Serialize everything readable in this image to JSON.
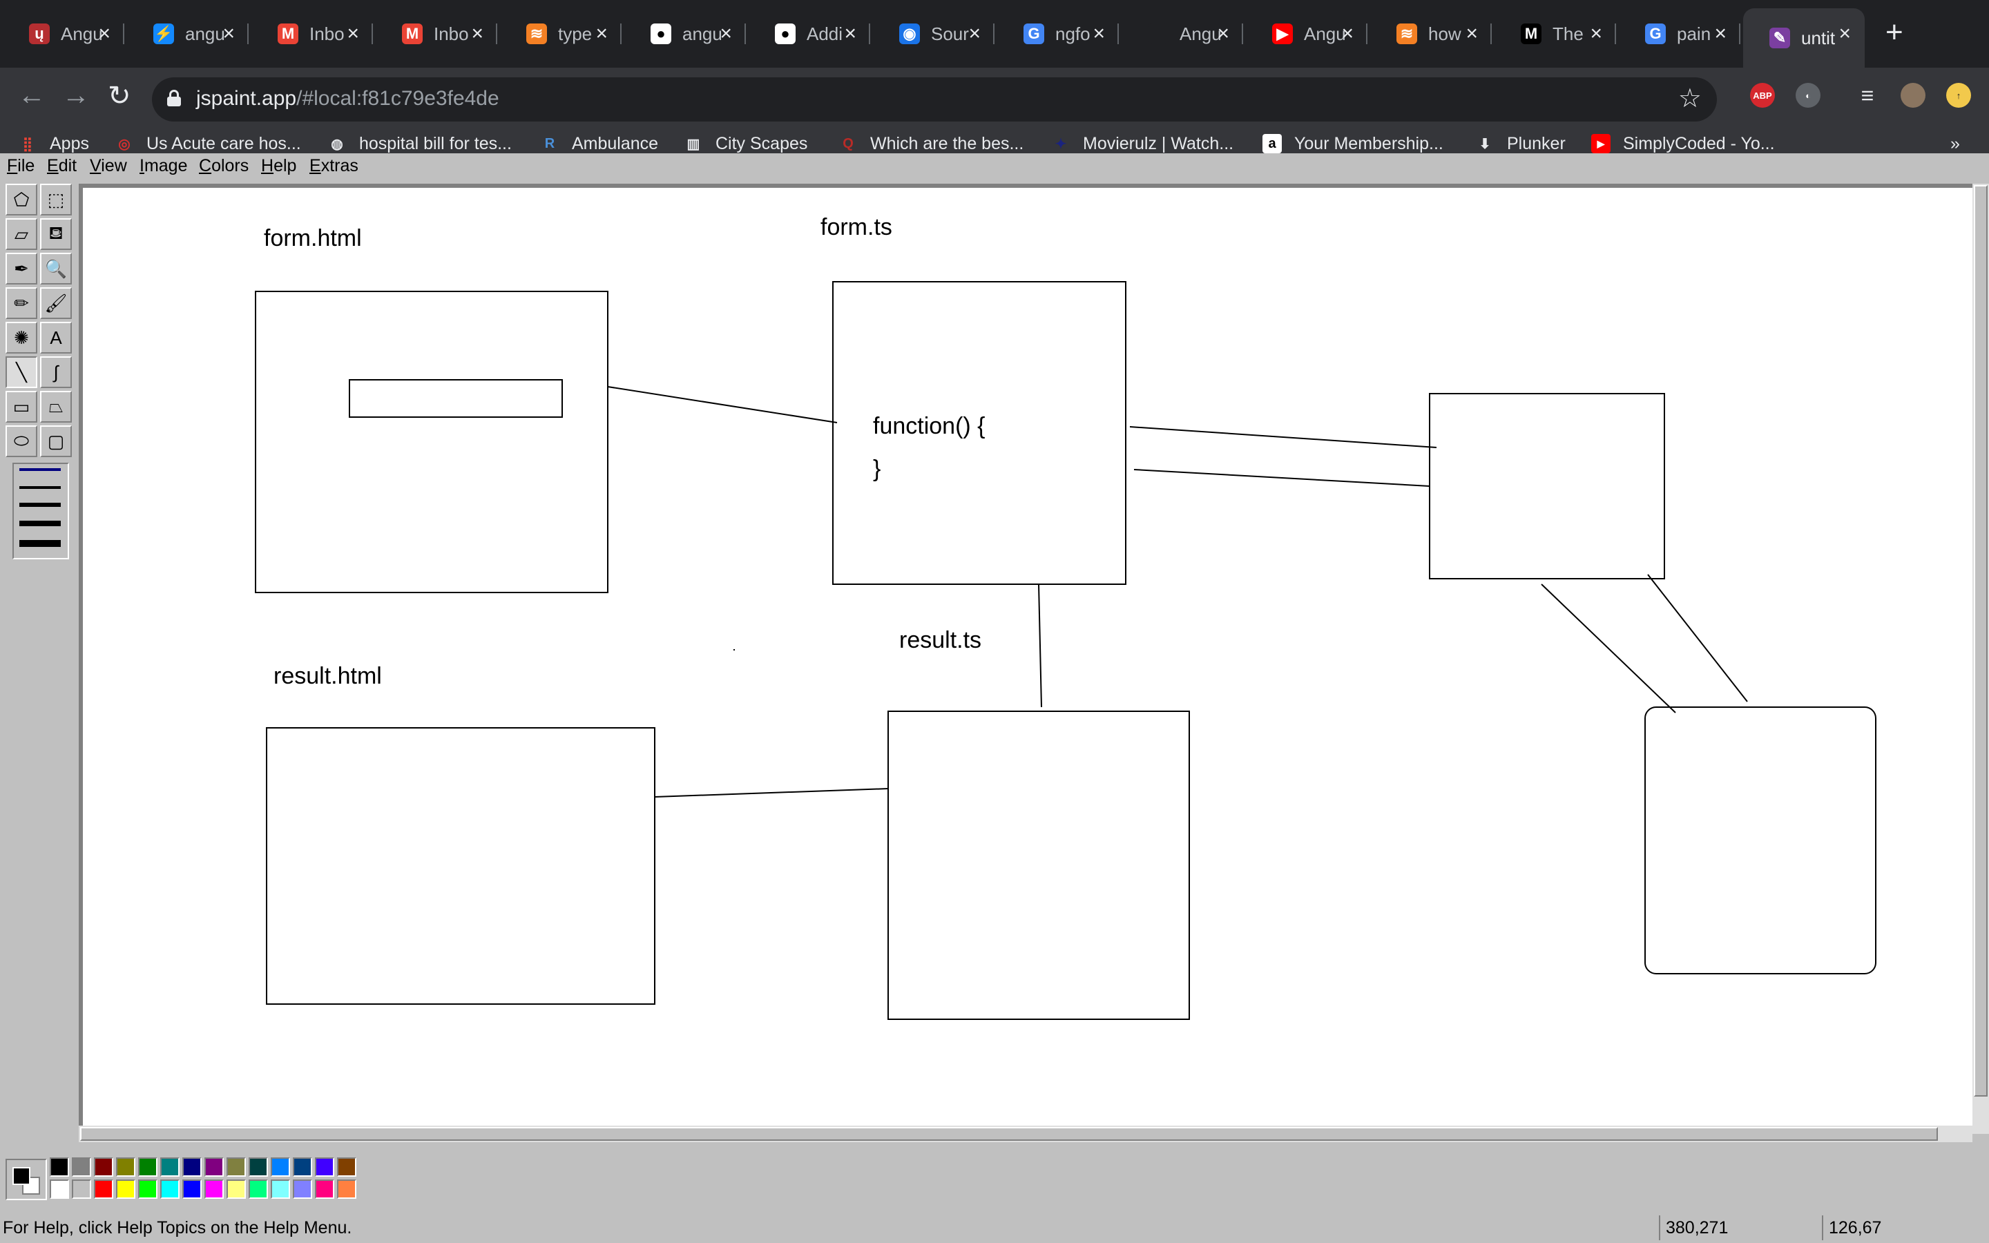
{
  "browser": {
    "tabs": [
      {
        "title": "Angu",
        "icon": "angular-icon",
        "color": "#b52e31",
        "glyph": "ų"
      },
      {
        "title": "angu",
        "icon": "stackblitz-icon",
        "color": "#1389fd",
        "glyph": "⚡"
      },
      {
        "title": "Inbo",
        "icon": "gmail-icon",
        "color": "#ea4335",
        "glyph": "M"
      },
      {
        "title": "Inbo",
        "icon": "gmail-icon",
        "color": "#ea4335",
        "glyph": "M"
      },
      {
        "title": "type",
        "icon": "stackoverflow-icon",
        "color": "#f48024",
        "glyph": "≋"
      },
      {
        "title": "angu",
        "icon": "github-icon",
        "color": "#ffffff",
        "glyph": "●"
      },
      {
        "title": "Addi",
        "icon": "github-icon",
        "color": "#ffffff",
        "glyph": "●"
      },
      {
        "title": "Sour",
        "icon": "sourcegraph-icon",
        "color": "#1a73e8",
        "glyph": "◉"
      },
      {
        "title": "ngfo",
        "icon": "google-icon",
        "color": "#4285f4",
        "glyph": "G"
      },
      {
        "title": "Angu",
        "icon": "blank-icon",
        "color": "#202124",
        "glyph": ""
      },
      {
        "title": "Angu",
        "icon": "youtube-icon",
        "color": "#ff0000",
        "glyph": "▶"
      },
      {
        "title": "how",
        "icon": "stackoverflow-icon",
        "color": "#f48024",
        "glyph": "≋"
      },
      {
        "title": "The",
        "icon": "medium-icon",
        "color": "#000000",
        "glyph": "M"
      },
      {
        "title": "pain",
        "icon": "google-icon",
        "color": "#4285f4",
        "glyph": "G"
      },
      {
        "title": "untit",
        "icon": "jspaint-icon",
        "color": "#7b3fa0",
        "glyph": "✎",
        "active": true
      }
    ],
    "new_tab": "+",
    "back": "←",
    "forward": "→",
    "reload": "↻",
    "url_host": "jspaint.app",
    "url_rest": "/#local:f81c79e3fe4de",
    "star": "☆",
    "extensions": [
      {
        "name": "adblock-plus-icon",
        "text": "ABP",
        "color": "#d6282e"
      },
      {
        "name": "extension-c-icon",
        "text": "◐",
        "color": "#5f6368"
      },
      {
        "name": "reading-list-icon",
        "text": "≡",
        "color": "#35363a"
      },
      {
        "name": "profile-avatar-icon",
        "text": "",
        "color": "#8a7560"
      },
      {
        "name": "update-icon",
        "text": "↑",
        "color": "#f2c94c"
      }
    ],
    "bookmarks": [
      {
        "label": "Apps",
        "icon": "apps-grid-icon",
        "color": "#ea4335",
        "glyph": "⣿"
      },
      {
        "label": "Us Acute care hos...",
        "icon": "site-icon",
        "color": "#d32f2f",
        "glyph": "◎"
      },
      {
        "label": "hospital bill for tes...",
        "icon": "globe-icon",
        "color": "#e8eaed",
        "glyph": "◍"
      },
      {
        "label": "Ambulance",
        "icon": "r-icon",
        "color": "#4a90d9",
        "glyph": "R"
      },
      {
        "label": "City Scapes",
        "icon": "cityscapes-icon",
        "color": "#e8eaed",
        "glyph": "▥"
      },
      {
        "label": "Which are the bes...",
        "icon": "quora-icon",
        "color": "#b92b27",
        "glyph": "Q"
      },
      {
        "label": "Movierulz | Watch...",
        "icon": "movierulz-icon",
        "color": "#1a237e",
        "glyph": "✦"
      },
      {
        "label": "Your Membership...",
        "icon": "amazon-icon",
        "color": "#ffffff",
        "glyph": "a"
      },
      {
        "label": "Plunker",
        "icon": "plunker-icon",
        "color": "#e8eaed",
        "glyph": "⬇"
      },
      {
        "label": "SimplyCoded - Yo...",
        "icon": "youtube-icon",
        "color": "#ff0000",
        "glyph": "▶"
      }
    ],
    "more_bookmarks": "»"
  },
  "paint": {
    "menus": [
      {
        "label": "File",
        "ul": "F",
        "rest": "ile"
      },
      {
        "label": "Edit",
        "ul": "E",
        "rest": "dit"
      },
      {
        "label": "View",
        "ul": "V",
        "rest": "iew"
      },
      {
        "label": "Image",
        "ul": "I",
        "rest": "mage"
      },
      {
        "label": "Colors",
        "ul": "C",
        "rest": "olors"
      },
      {
        "label": "Help",
        "ul": "H",
        "rest": "elp"
      },
      {
        "label": "Extras",
        "ul": "E",
        "rest": "xtras"
      }
    ],
    "tools": [
      {
        "name": "free-form-select-tool",
        "glyph": "⬠"
      },
      {
        "name": "rect-select-tool",
        "glyph": "⬚"
      },
      {
        "name": "eraser-tool",
        "glyph": "▱"
      },
      {
        "name": "fill-tool",
        "glyph": "⛾"
      },
      {
        "name": "color-picker-tool",
        "glyph": "✒"
      },
      {
        "name": "magnifier-tool",
        "glyph": "🔍"
      },
      {
        "name": "pencil-tool",
        "glyph": "✏"
      },
      {
        "name": "brush-tool",
        "glyph": "🖌"
      },
      {
        "name": "airbrush-tool",
        "glyph": "✺"
      },
      {
        "name": "text-tool",
        "glyph": "A"
      },
      {
        "name": "line-tool",
        "glyph": "╲",
        "pressed": true
      },
      {
        "name": "curve-tool",
        "glyph": "∫"
      },
      {
        "name": "rectangle-tool",
        "glyph": "▭"
      },
      {
        "name": "polygon-tool",
        "glyph": "⏢"
      },
      {
        "name": "ellipse-tool",
        "glyph": "⬭"
      },
      {
        "name": "rounded-rectangle-tool",
        "glyph": "▢"
      }
    ],
    "canvas_labels": {
      "form_html": "form.html",
      "form_ts": "form.ts",
      "result_ts": "result.ts",
      "result_html": "result.html",
      "code_line_1": "function() {",
      "code_line_2": "}"
    },
    "palette": {
      "foreground": "#000000",
      "background": "#ffffff",
      "top_row": [
        "#000000",
        "#808080",
        "#800000",
        "#808000",
        "#008000",
        "#008080",
        "#000080",
        "#800080",
        "#808040",
        "#004040",
        "#0080ff",
        "#004080",
        "#4000ff",
        "#804000"
      ],
      "bottom_row": [
        "#ffffff",
        "#c0c0c0",
        "#ff0000",
        "#ffff00",
        "#00ff00",
        "#00ffff",
        "#0000ff",
        "#ff00ff",
        "#ffff80",
        "#00ff80",
        "#80ffff",
        "#8080ff",
        "#ff0080",
        "#ff8040"
      ]
    },
    "status": {
      "help_text": "For Help, click Help Topics on the Help Menu.",
      "cursor_position": "380,271",
      "selection_size": "126,67"
    }
  }
}
